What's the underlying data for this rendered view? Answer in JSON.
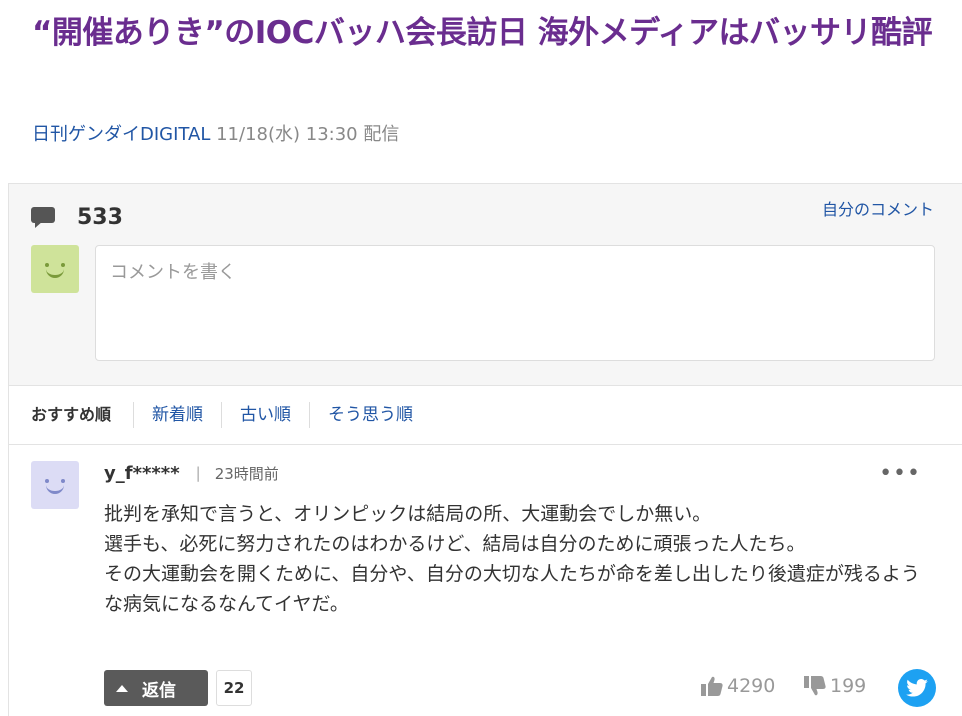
{
  "article": {
    "title": "“開催ありき”のIOCバッハ会長訪日 海外メディアはバッサリ酷評",
    "source": "日刊ゲンダイDIGITAL",
    "date": "11/18(水) 13:30",
    "posted_label": "配信"
  },
  "comments_header": {
    "count": "533",
    "my_comments_link": "自分のコメント",
    "input_placeholder": "コメントを書く"
  },
  "sort_tabs": [
    {
      "label": "おすすめ順",
      "active": true
    },
    {
      "label": "新着順",
      "active": false
    },
    {
      "label": "古い順",
      "active": false
    },
    {
      "label": "そう思う順",
      "active": false
    }
  ],
  "comment": {
    "username": "y_f*****",
    "separator": "|",
    "time": "23時間前",
    "lines": [
      "批判を承知で言うと、オリンピックは結局の所、大運動会でしか無い。",
      "選手も、必死に努力されたのはわかるけど、結局は自分のために頑張った人たち。",
      "その大運動会を開くために、自分や、自分の大切な人たちが命を差し出したり後遺症が残るような病気になるなんてイヤだ。"
    ],
    "reply_label": "返信",
    "reply_count": "22",
    "agree_count": "4290",
    "disagree_count": "199",
    "more_label": "•••"
  },
  "icons": {
    "comment": "speech-bubble-icon",
    "thumbs_up": "thumbs-up-icon",
    "thumbs_down": "thumbs-down-icon",
    "share": "twitter-icon",
    "more": "more-dots-icon"
  },
  "colors": {
    "title": "#6a2d8f",
    "link": "#2156a5",
    "reply_button": "#5a5a5a",
    "twitter": "#1da1f2"
  }
}
